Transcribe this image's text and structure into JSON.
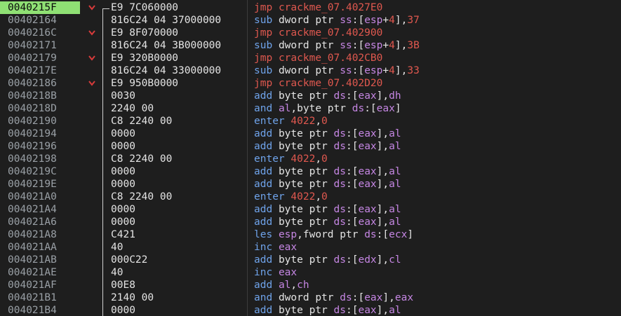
{
  "rows": [
    {
      "addr": "0040215F",
      "arrow": true,
      "bytes": "E9 7C060000",
      "mnemonic": "jmp",
      "operand": "crackme_07.4027E0",
      "selected": true
    },
    {
      "addr": "00402164",
      "arrow": false,
      "bytes": "816C24 04 37000000",
      "mnemonic": "sub",
      "operand": "dword ptr ss:[esp+4],37"
    },
    {
      "addr": "0040216C",
      "arrow": true,
      "bytes": "E9 8F070000",
      "mnemonic": "jmp",
      "operand": "crackme_07.402900"
    },
    {
      "addr": "00402171",
      "arrow": false,
      "bytes": "816C24 04 3B000000",
      "mnemonic": "sub",
      "operand": "dword ptr ss:[esp+4],3B"
    },
    {
      "addr": "00402179",
      "arrow": true,
      "bytes": "E9 320B0000",
      "mnemonic": "jmp",
      "operand": "crackme_07.402CB0"
    },
    {
      "addr": "0040217E",
      "arrow": false,
      "bytes": "816C24 04 33000000",
      "mnemonic": "sub",
      "operand": "dword ptr ss:[esp+4],33"
    },
    {
      "addr": "00402186",
      "arrow": true,
      "bytes": "E9 950B0000",
      "mnemonic": "jmp",
      "operand": "crackme_07.402D20"
    },
    {
      "addr": "0040218B",
      "arrow": false,
      "bytes": "0030",
      "mnemonic": "add",
      "operand": "byte ptr ds:[eax],dh"
    },
    {
      "addr": "0040218D",
      "arrow": false,
      "bytes": "2240 00",
      "mnemonic": "and",
      "operand": "al,byte ptr ds:[eax]"
    },
    {
      "addr": "00402190",
      "arrow": false,
      "bytes": "C8 2240 00",
      "mnemonic": "enter",
      "operand": "4022,0"
    },
    {
      "addr": "00402194",
      "arrow": false,
      "bytes": "0000",
      "mnemonic": "add",
      "operand": "byte ptr ds:[eax],al"
    },
    {
      "addr": "00402196",
      "arrow": false,
      "bytes": "0000",
      "mnemonic": "add",
      "operand": "byte ptr ds:[eax],al"
    },
    {
      "addr": "00402198",
      "arrow": false,
      "bytes": "C8 2240 00",
      "mnemonic": "enter",
      "operand": "4022,0"
    },
    {
      "addr": "0040219C",
      "arrow": false,
      "bytes": "0000",
      "mnemonic": "add",
      "operand": "byte ptr ds:[eax],al"
    },
    {
      "addr": "0040219E",
      "arrow": false,
      "bytes": "0000",
      "mnemonic": "add",
      "operand": "byte ptr ds:[eax],al"
    },
    {
      "addr": "004021A0",
      "arrow": false,
      "bytes": "C8 2240 00",
      "mnemonic": "enter",
      "operand": "4022,0"
    },
    {
      "addr": "004021A4",
      "arrow": false,
      "bytes": "0000",
      "mnemonic": "add",
      "operand": "byte ptr ds:[eax],al"
    },
    {
      "addr": "004021A6",
      "arrow": false,
      "bytes": "0000",
      "mnemonic": "add",
      "operand": "byte ptr ds:[eax],al"
    },
    {
      "addr": "004021A8",
      "arrow": false,
      "bytes": "C421",
      "mnemonic": "les",
      "operand": "esp,fword ptr ds:[ecx]"
    },
    {
      "addr": "004021AA",
      "arrow": false,
      "bytes": "40",
      "mnemonic": "inc",
      "operand": "eax"
    },
    {
      "addr": "004021AB",
      "arrow": false,
      "bytes": "000C22",
      "mnemonic": "add",
      "operand": "byte ptr ds:[edx],cl"
    },
    {
      "addr": "004021AE",
      "arrow": false,
      "bytes": "40",
      "mnemonic": "inc",
      "operand": "eax"
    },
    {
      "addr": "004021AF",
      "arrow": false,
      "bytes": "00E8",
      "mnemonic": "add",
      "operand": "al,ch"
    },
    {
      "addr": "004021B1",
      "arrow": false,
      "bytes": "2140 00",
      "mnemonic": "and",
      "operand": "dword ptr ds:[eax],eax"
    },
    {
      "addr": "004021B4",
      "arrow": false,
      "bytes": "0000",
      "mnemonic": "add",
      "operand": "byte ptr ds:[eax],al"
    }
  ],
  "colors": {
    "background": "#1e1e1e",
    "selected_address_bg": "#8fe074",
    "jump_mnemonic": "#e0584f",
    "mnemonic": "#6fa3ea",
    "register": "#c586e3",
    "number": "#e0584f",
    "arrow": "#d83b3b"
  },
  "icons": {
    "branch_arrow": "chevron-down-icon"
  }
}
